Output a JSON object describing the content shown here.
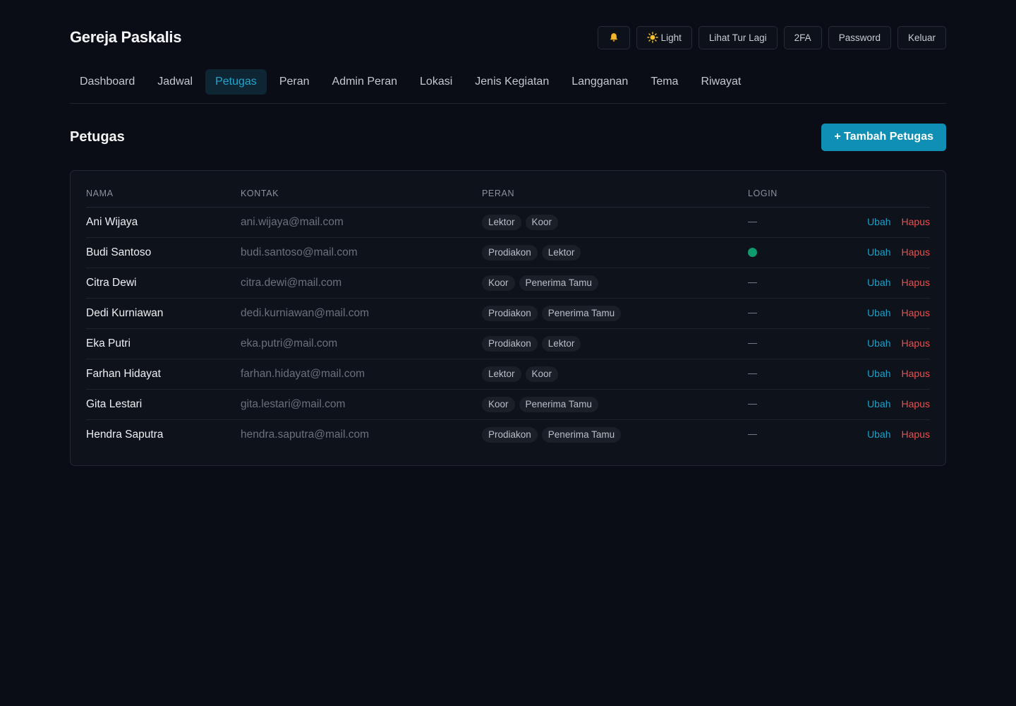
{
  "app": {
    "title": "Gereja Paskalis"
  },
  "header": {
    "bell_icon": "bell-icon",
    "theme_icon": "sun-icon",
    "theme_label": "Light",
    "tour_label": "Lihat Tur Lagi",
    "twofa_label": "2FA",
    "password_label": "Password",
    "logout_label": "Keluar"
  },
  "nav": {
    "tabs": [
      {
        "label": "Dashboard",
        "active": false
      },
      {
        "label": "Jadwal",
        "active": false
      },
      {
        "label": "Petugas",
        "active": true
      },
      {
        "label": "Peran",
        "active": false
      },
      {
        "label": "Admin Peran",
        "active": false
      },
      {
        "label": "Lokasi",
        "active": false
      },
      {
        "label": "Jenis Kegiatan",
        "active": false
      },
      {
        "label": "Langganan",
        "active": false
      },
      {
        "label": "Tema",
        "active": false
      },
      {
        "label": "Riwayat",
        "active": false
      }
    ]
  },
  "main": {
    "title": "Petugas",
    "add_label": "+ Tambah Petugas",
    "columns": {
      "name": "NAMA",
      "contact": "KONTAK",
      "role": "PERAN",
      "login": "LOGIN"
    },
    "edit_label": "Ubah",
    "delete_label": "Hapus",
    "rows": [
      {
        "name": "Ani Wijaya",
        "contact": "ani.wijaya@mail.com",
        "roles": [
          "Lektor",
          "Koor"
        ],
        "login": false
      },
      {
        "name": "Budi Santoso",
        "contact": "budi.santoso@mail.com",
        "roles": [
          "Prodiakon",
          "Lektor"
        ],
        "login": true
      },
      {
        "name": "Citra Dewi",
        "contact": "citra.dewi@mail.com",
        "roles": [
          "Koor",
          "Penerima Tamu"
        ],
        "login": false
      },
      {
        "name": "Dedi Kurniawan",
        "contact": "dedi.kurniawan@mail.com",
        "roles": [
          "Prodiakon",
          "Penerima Tamu"
        ],
        "login": false
      },
      {
        "name": "Eka Putri",
        "contact": "eka.putri@mail.com",
        "roles": [
          "Prodiakon",
          "Lektor"
        ],
        "login": false
      },
      {
        "name": "Farhan Hidayat",
        "contact": "farhan.hidayat@mail.com",
        "roles": [
          "Lektor",
          "Koor"
        ],
        "login": false
      },
      {
        "name": "Gita Lestari",
        "contact": "gita.lestari@mail.com",
        "roles": [
          "Koor",
          "Penerima Tamu"
        ],
        "login": false
      },
      {
        "name": "Hendra Saputra",
        "contact": "hendra.saputra@mail.com",
        "roles": [
          "Prodiakon",
          "Penerima Tamu"
        ],
        "login": false
      }
    ]
  },
  "colors": {
    "background": "#0a0d15",
    "accent": "#0e8fb3",
    "active_tab_text": "#22a6cf",
    "edit_link": "#1f9fc8",
    "delete_link": "#ef4d4d",
    "login_active": "#0f9b6e"
  }
}
